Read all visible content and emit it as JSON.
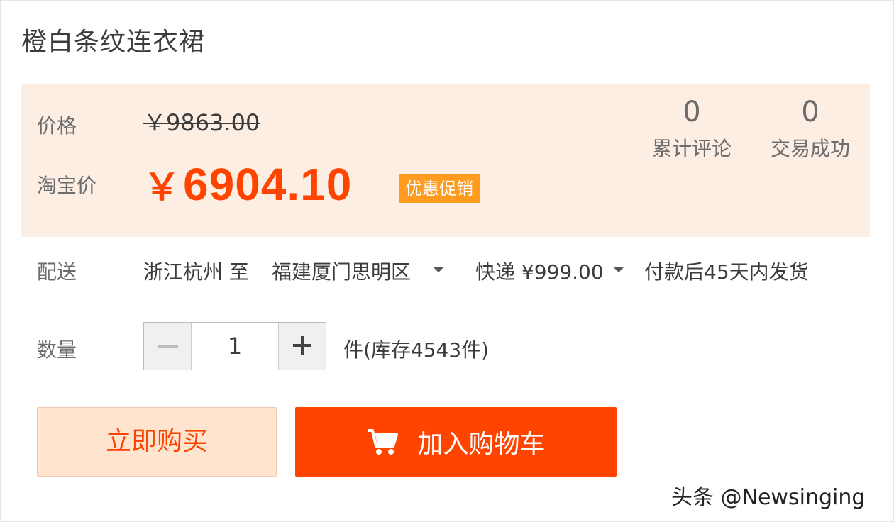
{
  "product": {
    "title": "橙白条纹连衣裙"
  },
  "pricing": {
    "price_label": "价格",
    "original_price": "￥9863.00",
    "taobao_label": "淘宝价",
    "currency_symbol": "￥",
    "promo_price": "6904.10",
    "promo_tag": "优惠促销"
  },
  "stats": {
    "reviews_count": "0",
    "reviews_label": "累计评论",
    "deals_count": "0",
    "deals_label": "交易成功"
  },
  "shipping": {
    "label": "配送",
    "route": "浙江杭州 至",
    "destination": "福建厦门思明区",
    "method": "快递 ¥999.00",
    "delivery_note": "付款后45天内发货"
  },
  "quantity": {
    "label": "数量",
    "value": "1",
    "stock_text": "件(库存4543件)"
  },
  "actions": {
    "buy_now": "立即购买",
    "add_to_cart": "加入购物车"
  },
  "watermark": "头条 @Newsinging",
  "colors": {
    "accent": "#ff4400",
    "promo_tag_bg": "#ff9b1f",
    "price_panel_bg": "#fdeee4",
    "buy_now_bg": "#ffe4d0"
  },
  "icons": {
    "cart": "shopping-cart-icon",
    "dropdown": "caret-down-icon",
    "minus": "minus-icon",
    "plus": "plus-icon"
  }
}
